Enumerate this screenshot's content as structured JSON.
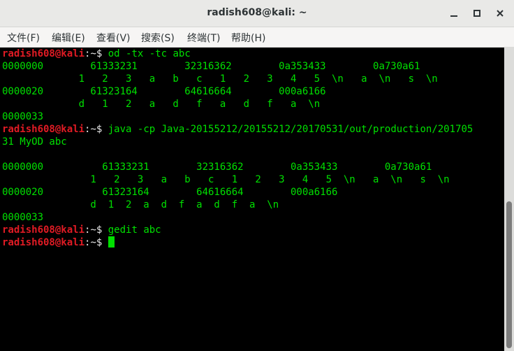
{
  "window": {
    "title": "radish608@kali: ~"
  },
  "menu": [
    {
      "label": "文件(F)"
    },
    {
      "label": "编辑(E)"
    },
    {
      "label": "查看(V)"
    },
    {
      "label": "搜索(S)"
    },
    {
      "label": "终端(T)"
    },
    {
      "label": "帮助(H)"
    }
  ],
  "terminal": {
    "prompt_user": "radish608@kali",
    "prompt_sep": ":",
    "prompt_path": "~$",
    "lines": [
      {
        "kind": "prompt",
        "cmd": " od -tx -tc abc"
      },
      {
        "kind": "out",
        "text": "0000000        61333231        32316362        0a353433        0a730a61"
      },
      {
        "kind": "out",
        "text": "             1   2   3   a   b   c   1   2   3   4   5  \\n   a  \\n   s  \\n"
      },
      {
        "kind": "out",
        "text": "0000020        61323164        64616664        000a6166"
      },
      {
        "kind": "out",
        "text": "             d   1   2   a   d   f   a   d   f   a  \\n"
      },
      {
        "kind": "out",
        "text": "0000033"
      },
      {
        "kind": "prompt",
        "cmd": " java -cp Java-20155212/20155212/20170531/out/production/201705"
      },
      {
        "kind": "out",
        "text": "31 MyOD abc"
      },
      {
        "kind": "out",
        "text": ""
      },
      {
        "kind": "out",
        "text": "0000000          61333231        32316362        0a353433        0a730a61"
      },
      {
        "kind": "out",
        "text": "               1   2   3   a   b   c   1   2   3   4   5  \\n   a  \\n   s  \\n"
      },
      {
        "kind": "out",
        "text": "0000020          61323164        64616664        000a6166"
      },
      {
        "kind": "out",
        "text": "               d  1  2  a  d  f  a  d  f  a  \\n"
      },
      {
        "kind": "out",
        "text": "0000033"
      },
      {
        "kind": "prompt",
        "cmd": " gedit abc"
      },
      {
        "kind": "prompt",
        "cmd": " ",
        "cursor": true
      }
    ]
  },
  "colors": {
    "text": "#00e000",
    "prompt": "#e01b24",
    "background": "#000000"
  },
  "icons": {
    "minimize": "minimize-icon",
    "maximize": "maximize-icon",
    "close": "close-icon"
  }
}
